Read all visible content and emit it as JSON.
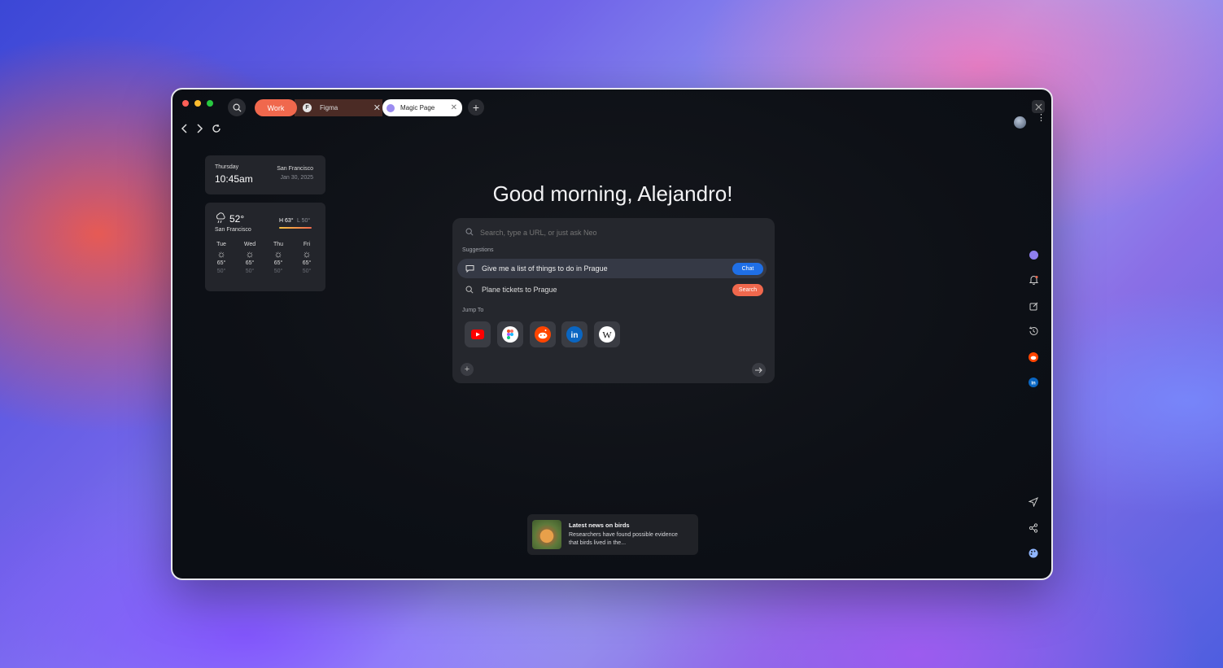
{
  "tabs": {
    "group_label": "Work",
    "items": [
      {
        "label": "Figma",
        "favicon": "F"
      },
      {
        "label": "Magic Page"
      }
    ]
  },
  "clock_widget": {
    "day": "Thursday",
    "time": "10:45am",
    "city": "San Francisco",
    "date": "Jan 30, 2025"
  },
  "weather_widget": {
    "temp": "52°",
    "city": "San Francisco",
    "high": "H 63°",
    "low": "L 50°",
    "forecast": [
      {
        "day": "Tue",
        "high": "65°",
        "low": "50°"
      },
      {
        "day": "Wed",
        "high": "65°",
        "low": "50°"
      },
      {
        "day": "Thu",
        "high": "65°",
        "low": "50°"
      },
      {
        "day": "Fri",
        "high": "65°",
        "low": "50°"
      }
    ]
  },
  "greeting": "Good morning, Alejandro!",
  "search": {
    "placeholder": "Search, type a URL, or just ask Neo",
    "suggestions_label": "Suggestions",
    "suggestions": [
      {
        "text": "Give me a list of things to do in Prague",
        "action": "Chat"
      },
      {
        "text": "Plane tickets to Prague",
        "action": "Search"
      }
    ],
    "jump_to_label": "Jump To",
    "shortcuts": [
      "youtube",
      "figma",
      "reddit",
      "linkedin",
      "wikipedia"
    ]
  },
  "news": {
    "title": "Latest news on birds",
    "body_line1": "Researchers have found possible evidence",
    "body_line2": "that birds lived in the..."
  },
  "colors": {
    "accent_orange": "#f0684d",
    "accent_blue": "#1f6fe6",
    "window_bg": "#0d1016",
    "card_bg": "#23252b"
  }
}
